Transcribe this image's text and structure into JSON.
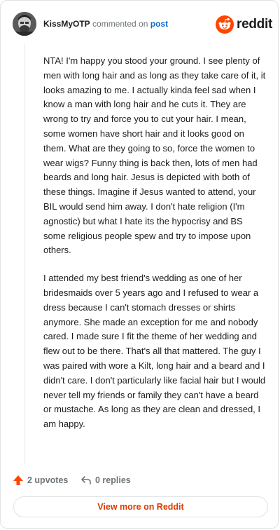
{
  "header": {
    "username": "KissMyOTP",
    "action_text": "commented on",
    "post_link": "post",
    "brand_name": "reddit"
  },
  "comment": {
    "paragraphs": [
      "NTA! I'm happy you stood your ground. I see plenty of men with long hair and as long as they take care of it, it looks amazing to me. I actually kinda feel sad when I know a man with long hair and he cuts it. They are wrong to try and force you to cut your hair. I mean, some women have short hair and it looks good on them. What are they going to so, force the women to wear wigs? Funny thing is back then, lots of men had beards and long hair. Jesus is depicted with both of these things. Imagine if Jesus wanted to attend, your BIL would send him away. I don't hate religion (I'm agnostic) but what I hate its the hypocrisy and BS some religious people spew and try to impose upon others.",
      "I attended my best friend's wedding as one of her bridesmaids over 5 years ago and I refused to wear a dress because I can't stomach dresses or shirts anymore. She made an exception for me and nobody cared. I made sure I fit the theme of her wedding and flew out to be there. That's all that mattered. The guy I was paired with wore a Kilt, long hair and a beard and I didn't care. I don't particularly like facial hair but I would never tell my friends or family they can't have a beard or mustache. As long as they are clean and dressed, I am happy."
    ]
  },
  "footer": {
    "upvotes_label": "2 upvotes",
    "replies_label": "0 replies",
    "view_more_label": "View more on Reddit"
  },
  "colors": {
    "brand": "#ff4500",
    "link": "#0b6bd1",
    "cta": "#d93a00"
  },
  "icons": [
    "avatar",
    "reddit-logo-icon",
    "upvote-arrow-icon",
    "reply-arrow-icon"
  ]
}
